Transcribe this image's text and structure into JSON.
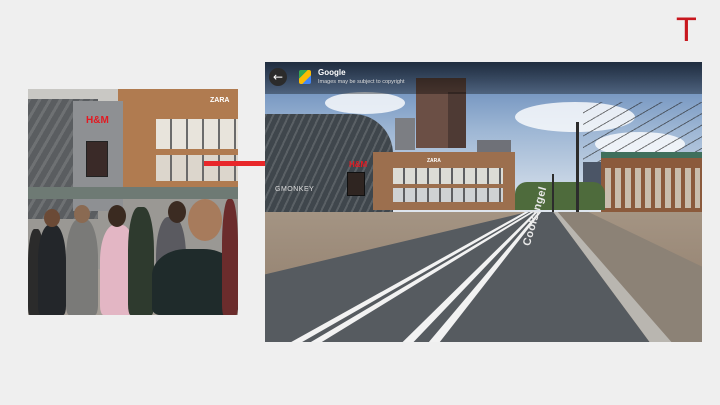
{
  "brand": {
    "logo_letter": "T",
    "accent": "#c8171e"
  },
  "photo_left": {
    "storefront_sign": "H&M",
    "building_sign": "ZARA"
  },
  "arrow": {
    "color": "#e8272a"
  },
  "streetview": {
    "back_icon": "arrow-left-icon",
    "back_glyph": "←",
    "provider": "Google",
    "copyright_notice": "Images may be subject to copyright",
    "storefront_sign": "H&M",
    "building_sign": "ZARA",
    "facade_sign": "GMONKEY",
    "street_label": "Coolsingel"
  }
}
